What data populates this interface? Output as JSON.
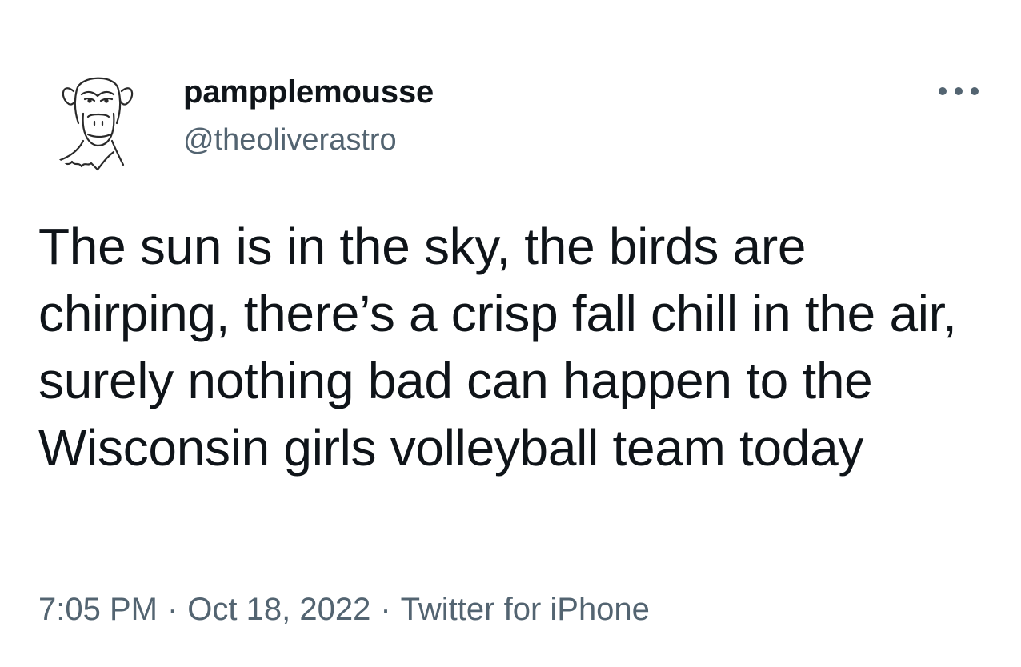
{
  "author": {
    "display_name": "pampplemousse",
    "handle": "@theoliverastro",
    "avatar_icon": "ape-sketch-avatar"
  },
  "menu": {
    "icon": "more-horizontal-icon",
    "glyph": "•••"
  },
  "tweet": {
    "text": "The sun is in the sky, the birds are chirping, there’s a crisp fall chill in the air, surely nothing bad can happen to the Wisconsin girls volleyball team today"
  },
  "meta": {
    "time": "7:05 PM",
    "separator": "·",
    "date": "Oct 18, 2022",
    "source": "Twitter for iPhone"
  },
  "colors": {
    "text_primary": "#0f1419",
    "text_secondary": "#536471",
    "background": "#ffffff"
  }
}
